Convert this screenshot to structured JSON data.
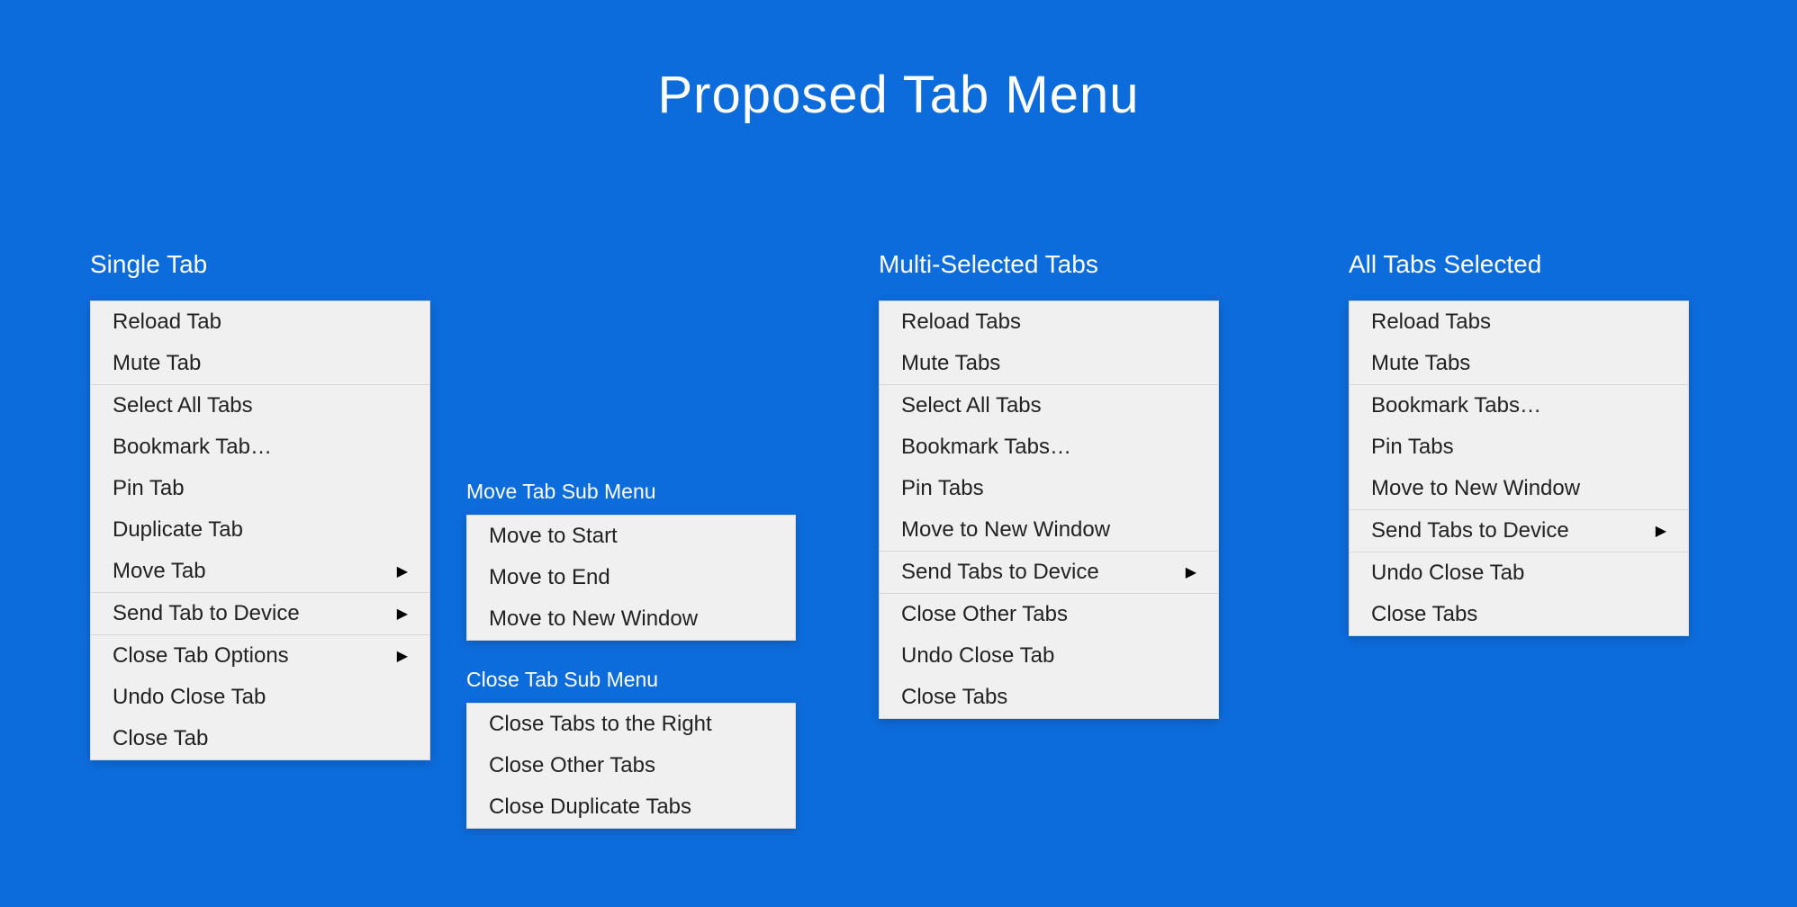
{
  "title": "Proposed Tab Menu",
  "columns": {
    "single": {
      "header": "Single Tab",
      "items": {
        "reload": "Reload Tab",
        "mute": "Mute Tab",
        "select_all": "Select All Tabs",
        "bookmark": "Bookmark Tab…",
        "pin": "Pin Tab",
        "duplicate": "Duplicate Tab",
        "move": "Move Tab",
        "send": "Send Tab to Device",
        "close_options": "Close Tab Options",
        "undo_close": "Undo Close Tab",
        "close": "Close Tab"
      }
    },
    "move_sub": {
      "header": "Move Tab Sub Menu",
      "items": {
        "start": "Move to Start",
        "end": "Move to End",
        "new_window": "Move to New Window"
      }
    },
    "close_sub": {
      "header": "Close Tab Sub Menu",
      "items": {
        "right": "Close Tabs to the Right",
        "other": "Close Other Tabs",
        "duplicates": "Close Duplicate Tabs"
      }
    },
    "multi": {
      "header": "Multi-Selected Tabs",
      "items": {
        "reload": "Reload Tabs",
        "mute": "Mute Tabs",
        "select_all": "Select All Tabs",
        "bookmark": "Bookmark Tabs…",
        "pin": "Pin Tabs",
        "new_window": "Move to New Window",
        "send": "Send Tabs to Device",
        "close_other": "Close Other Tabs",
        "undo_close": "Undo Close Tab",
        "close": "Close Tabs"
      }
    },
    "all": {
      "header": "All Tabs Selected",
      "items": {
        "reload": "Reload Tabs",
        "mute": "Mute Tabs",
        "bookmark": "Bookmark Tabs…",
        "pin": "Pin Tabs",
        "new_window": "Move to New Window",
        "send": "Send Tabs to Device",
        "undo_close": "Undo Close Tab",
        "close": "Close Tabs"
      }
    }
  }
}
